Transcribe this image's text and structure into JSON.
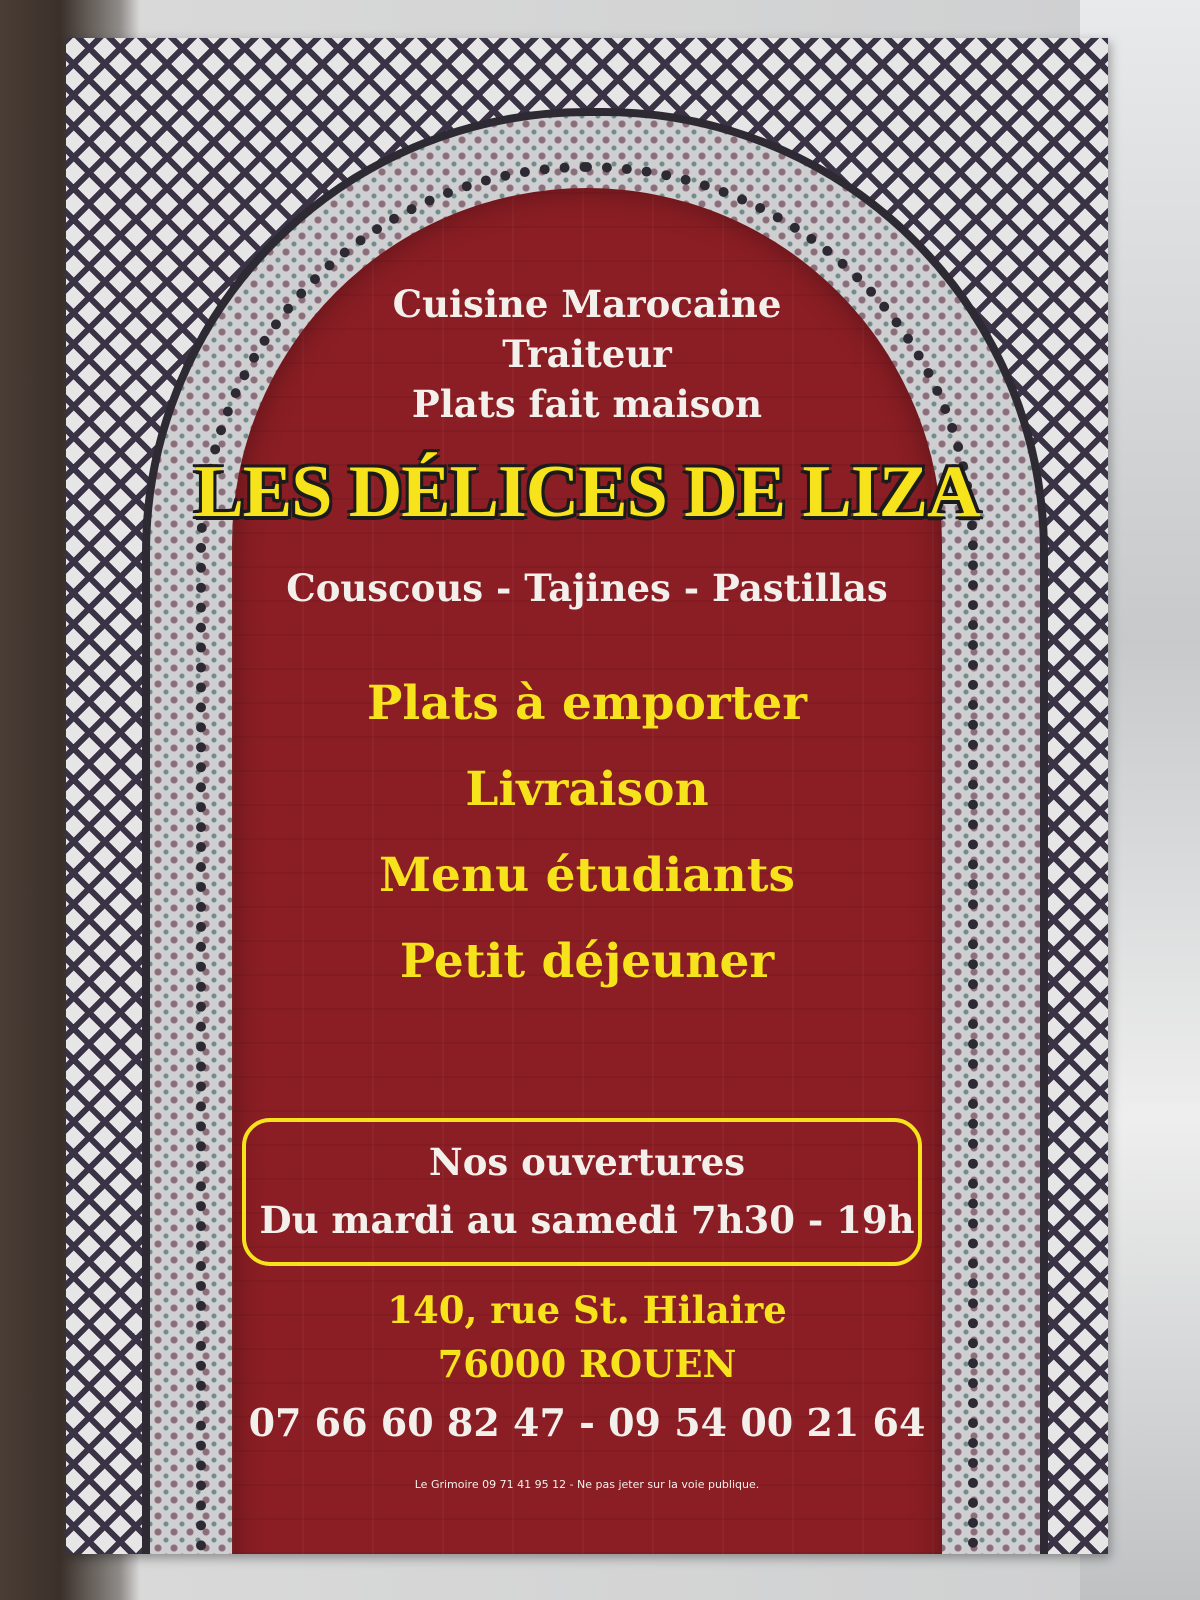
{
  "header": {
    "lines": [
      "Cuisine Marocaine",
      "Traiteur",
      "Plats fait maison"
    ]
  },
  "title": "LES DÉLICES DE LIZA",
  "specialties": "Couscous - Tajines - Pastillas",
  "services": [
    "Plats à emporter",
    "Livraison",
    "Menu étudiants",
    "Petit déjeuner"
  ],
  "hours": {
    "heading": "Nos ouvertures",
    "text": "Du mardi au samedi 7h30 - 19h"
  },
  "address": {
    "street": "140, rue St. Hilaire",
    "city": "76000 ROUEN"
  },
  "phones": "07 66 60 82 47 - 09 54 00 21 64",
  "footer_note": "Le Grimoire 09 71 41 95 12 - Ne pas jeter sur la voie publique.",
  "colors": {
    "arch_red": "#8a1e24",
    "title_yellow": "#f6e31c",
    "text_white": "#f3f0ec"
  }
}
